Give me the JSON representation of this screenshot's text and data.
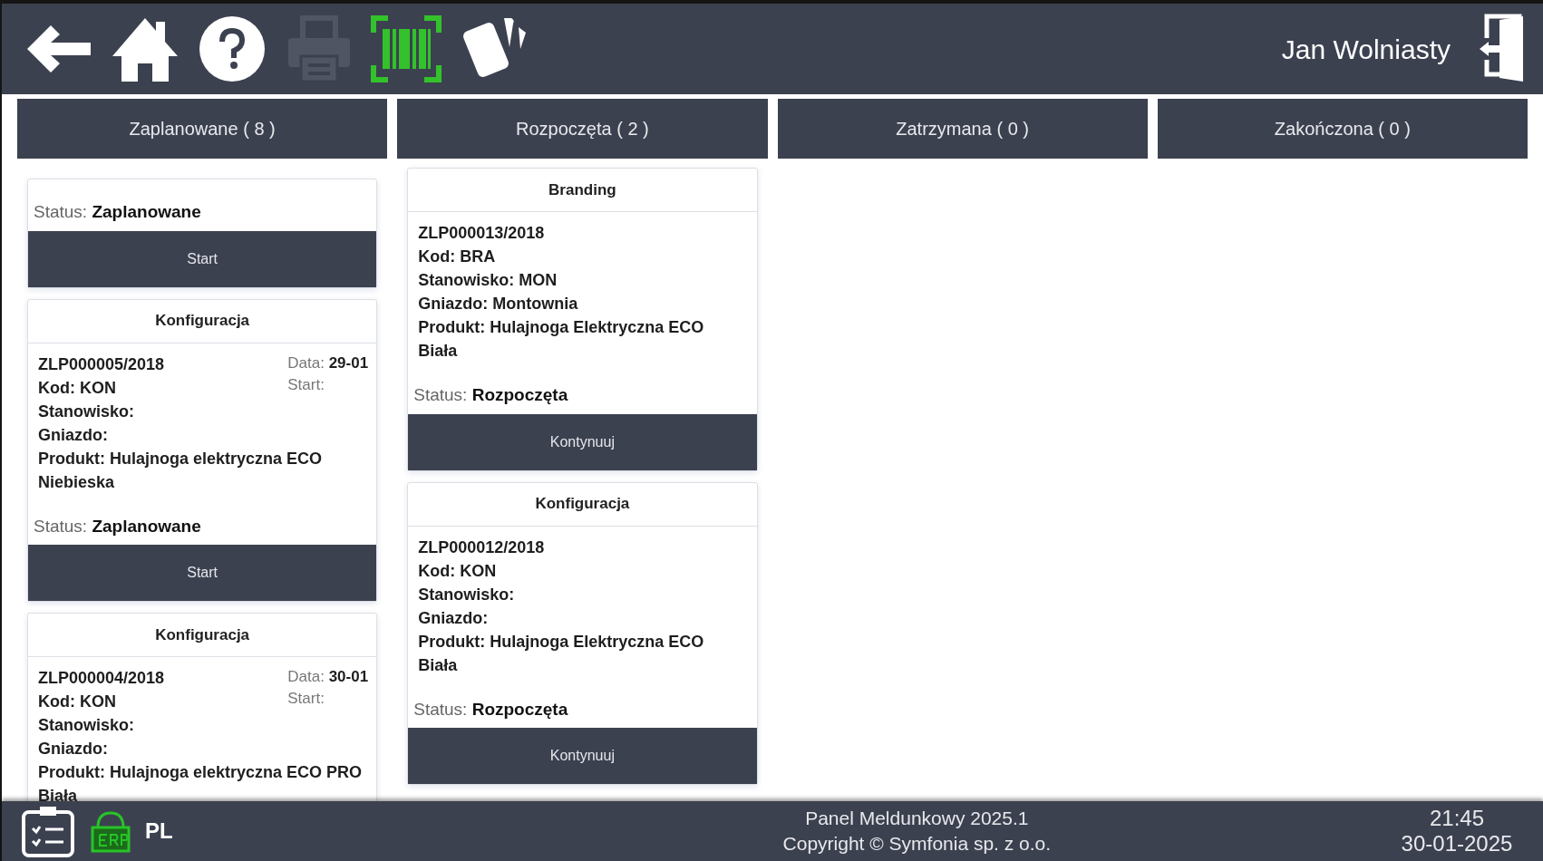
{
  "toolbar": {
    "icons": [
      {
        "kind": "back",
        "disabled": false
      },
      {
        "kind": "home",
        "disabled": false
      },
      {
        "kind": "help",
        "disabled": false
      },
      {
        "kind": "print",
        "disabled": true
      },
      {
        "kind": "scan",
        "disabled": false
      },
      {
        "kind": "cards",
        "disabled": false
      }
    ],
    "user": "Jan Wolniasty"
  },
  "tabs": [
    {
      "label": "Zaplanowane ( 8 )",
      "selected": false
    },
    {
      "label": "Rozpoczęta ( 2 )",
      "selected": false
    },
    {
      "label": "Zatrzymana ( 0 )",
      "selected": false
    },
    {
      "label": "Zakończona ( 0 )",
      "selected": false
    }
  ],
  "columns": [
    {
      "cards": [
        {
          "status_label": "Status:",
          "status": "Zaplanowane",
          "button": "Start"
        },
        {
          "title": "Konfiguracja",
          "lines": [
            "ZLP000005/2018",
            "Kod: KON",
            "Stanowisko:",
            "Gniazdo:",
            "Produkt: Hulajnoga elektryczna ECO Niebieska"
          ],
          "date_label": "Data:",
          "date": "29-01",
          "start_label": "Start:",
          "status_label": "Status:",
          "status": "Zaplanowane",
          "button": "Start"
        },
        {
          "title": "Konfiguracja",
          "lines": [
            "ZLP000004/2018",
            "Kod: KON",
            "Stanowisko:",
            "Gniazdo:",
            "Produkt: Hulajnoga elektryczna ECO PRO Biała"
          ],
          "date_label": "Data:",
          "date": "30-01",
          "start_label": "Start:"
        }
      ]
    },
    {
      "cards": [
        {
          "title": "Branding",
          "lines": [
            "ZLP000013/2018",
            "Kod: BRA",
            "Stanowisko: MON",
            "Gniazdo: Montownia",
            "Produkt: Hulajnoga Elektryczna ECO Biała"
          ],
          "status_label": "Status:",
          "status": "Rozpoczęta",
          "button": "Kontynuuj"
        },
        {
          "title": "Konfiguracja",
          "lines": [
            "ZLP000012/2018",
            "Kod: KON",
            "Stanowisko:",
            "Gniazdo:",
            "Produkt: Hulajnoga Elektryczna ECO Biała"
          ],
          "status_label": "Status:",
          "status": "Rozpoczęta",
          "button": "Kontynuuj"
        }
      ]
    },
    {},
    {}
  ],
  "footer": {
    "language": "PL",
    "app": "Panel Meldunkowy 2025.1",
    "copyright": "Copyright © Symfonia sp. z o.o.",
    "time": "21:45",
    "date": "30-01-2025"
  }
}
